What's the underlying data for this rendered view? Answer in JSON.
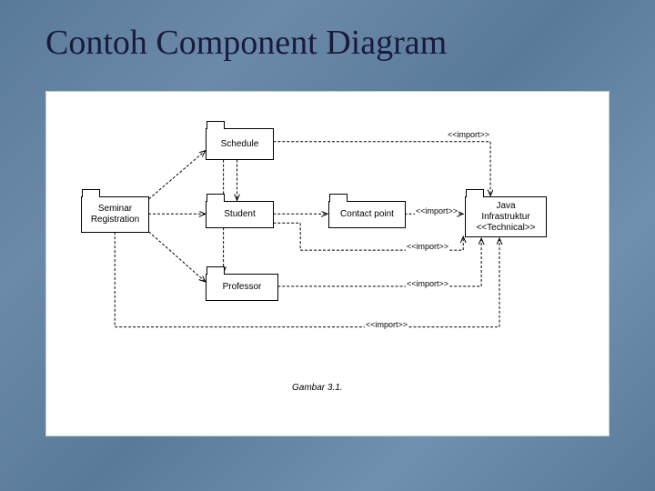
{
  "title": "Contoh Component Diagram",
  "caption": "Gambar 3.1.",
  "packages": {
    "seminar": {
      "label": "Seminar Registration"
    },
    "schedule": {
      "label": "Schedule"
    },
    "student": {
      "label": "Student"
    },
    "professor": {
      "label": "Professor"
    },
    "contact": {
      "label": "Contact point"
    },
    "java": {
      "label_line1": "Java",
      "label_line2": "Infrastruktur",
      "label_line3": "<<Technical>>"
    }
  },
  "edgeLabels": {
    "import1": "<<import>>",
    "import2": "<<import>>",
    "import3": "<<import>>",
    "import4": "<<import>>",
    "import5": "<<import>>"
  }
}
